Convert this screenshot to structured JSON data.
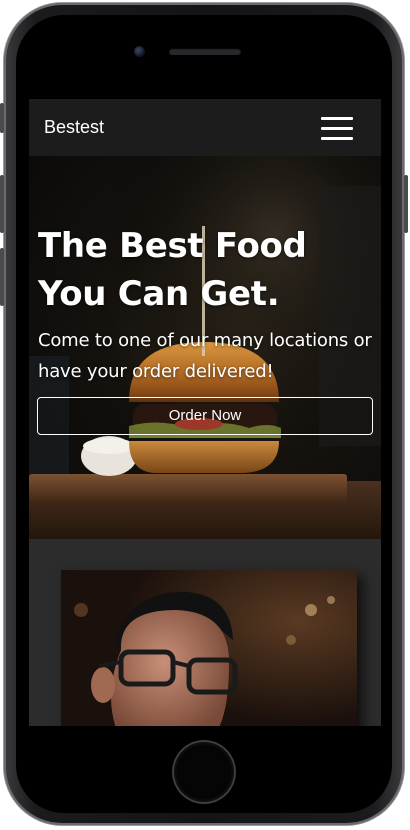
{
  "navbar": {
    "brand": "Bestest",
    "menu_icon": "hamburger-menu-icon"
  },
  "hero": {
    "title_line1": "The Best Food",
    "title_line2": "You Can Get.",
    "subtitle_line1": "Come to one of our many locations or",
    "subtitle_line2": "have your order delivered!",
    "cta_label": "Order Now",
    "background_image": "burger-photo"
  },
  "feature": {
    "image": "person-with-glasses-photo"
  },
  "colors": {
    "navbar_bg": "#1c1c1c",
    "text": "#ffffff",
    "section_bg": "#2c2c2c"
  }
}
